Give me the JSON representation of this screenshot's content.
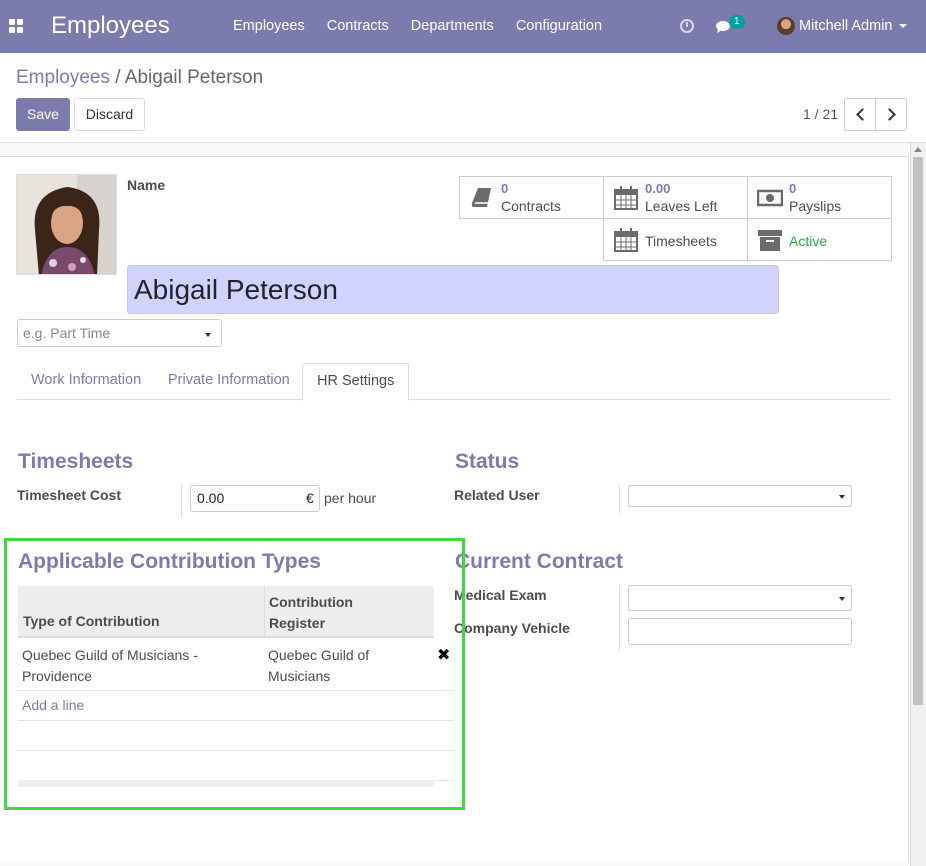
{
  "navbar": {
    "app_title": "Employees",
    "menu": [
      "Employees",
      "Contracts",
      "Departments",
      "Configuration"
    ],
    "chat_count": "1",
    "user_name": "Mitchell Admin"
  },
  "breadcrumb": {
    "parent": "Employees",
    "separator": "/",
    "current": "Abigail Peterson"
  },
  "toolbar": {
    "save_label": "Save",
    "discard_label": "Discard",
    "pager": "1 / 21"
  },
  "employee": {
    "name_label": "Name",
    "name": "Abigail Peterson",
    "job_placeholder": "e.g. Part Time"
  },
  "smart_buttons": {
    "contracts": {
      "value": "0",
      "label": "Contracts"
    },
    "leaves": {
      "value": "0.00",
      "label": "Leaves Left"
    },
    "payslips": {
      "value": "0",
      "label": "Payslips"
    },
    "timesheets": {
      "label": "Timesheets"
    },
    "active": {
      "label": "Active",
      "color": "#28a745"
    }
  },
  "tabs": [
    "Work Information",
    "Private Information",
    "HR Settings"
  ],
  "timesheets": {
    "title": "Timesheets",
    "cost_label": "Timesheet Cost",
    "cost_value": "0.00",
    "currency": "€",
    "unit": "per hour"
  },
  "status": {
    "title": "Status",
    "related_user_label": "Related User"
  },
  "contribution": {
    "title": "Applicable Contribution Types",
    "col_type": "Type of Contribution",
    "col_register": "Contribution Register",
    "rows": [
      {
        "type": "Quebec Guild of Musicians - Providence",
        "register": "Quebec Guild of Musicians"
      }
    ],
    "add_line": "Add a line"
  },
  "current_contract": {
    "title": "Current Contract",
    "medical_exam_label": "Medical Exam",
    "company_vehicle_label": "Company Vehicle"
  },
  "colors": {
    "brand": "#7c7bad",
    "name_highlight": "#d2d2ff",
    "annotation_box": "#3fd93f"
  }
}
